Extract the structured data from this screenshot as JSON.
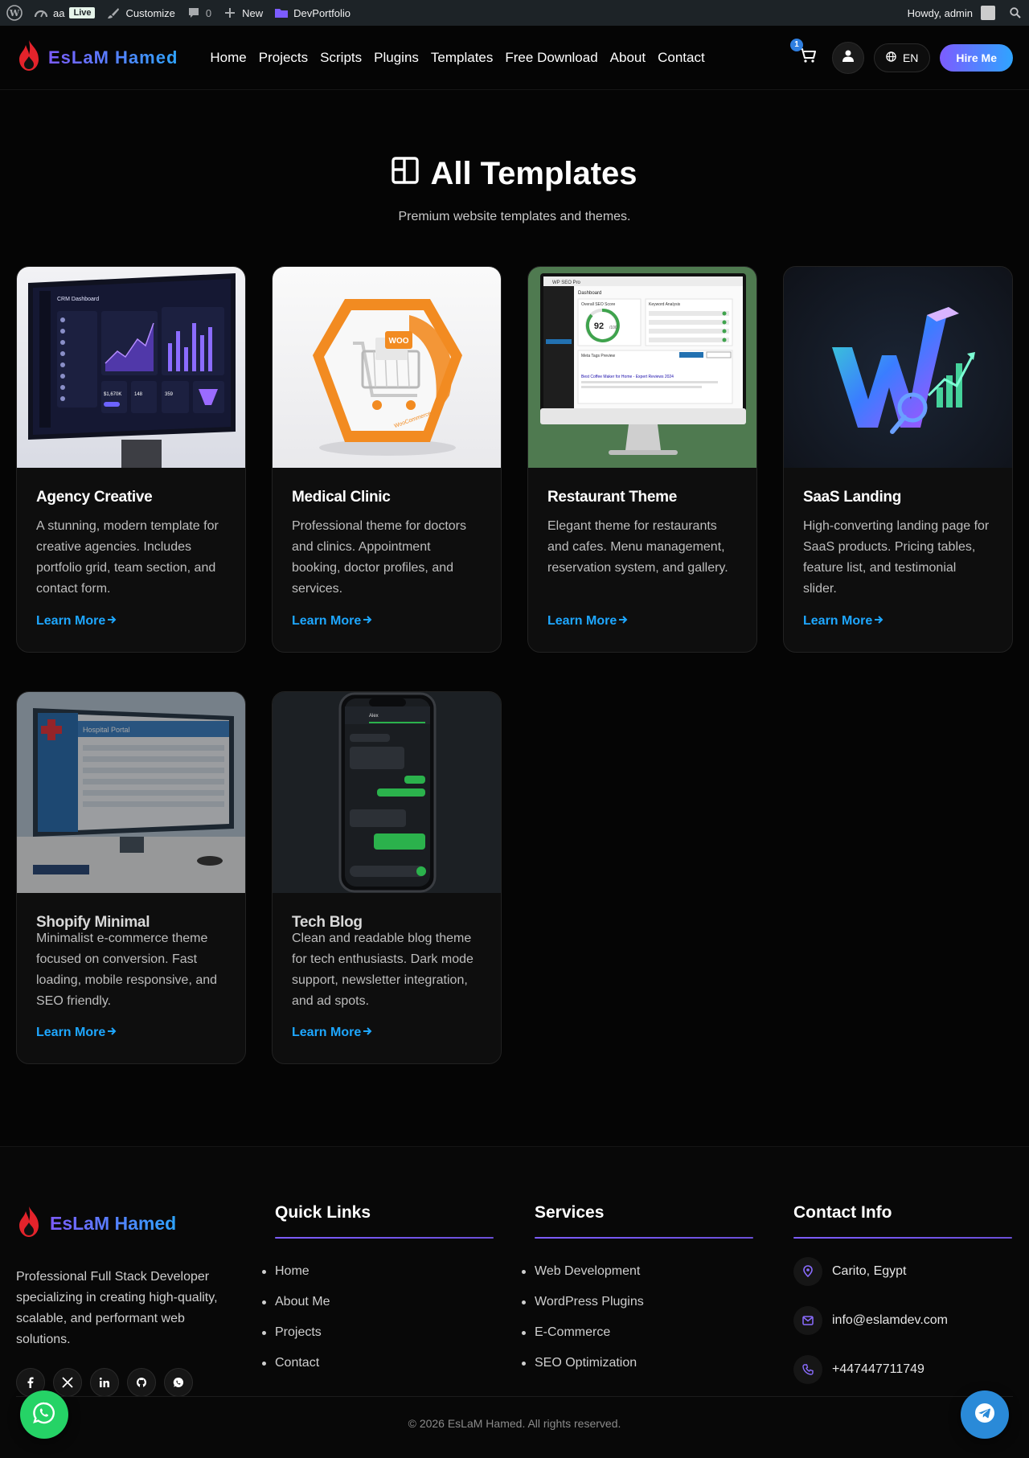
{
  "adminbar": {
    "site": "aa",
    "live": "Live",
    "customize": "Customize",
    "comments": "0",
    "new": "New",
    "plugin": "DevPortfolio",
    "howdy": "Howdy, admin"
  },
  "header": {
    "logo": "EsLaM Hamed",
    "nav": [
      "Home",
      "Projects",
      "Scripts",
      "Plugins",
      "Templates",
      "Free Download",
      "About",
      "Contact"
    ],
    "cart_count": "1",
    "lang": "EN",
    "hire": "Hire Me"
  },
  "hero": {
    "title": "All Templates",
    "subtitle": "Premium website templates and themes."
  },
  "cards": [
    {
      "title": "Agency Creative",
      "desc": "A stunning, modern template for creative agencies. Includes portfolio grid, team section, and contact form.",
      "link": "Learn More"
    },
    {
      "title": "Medical Clinic",
      "desc": "Professional theme for doctors and clinics. Appointment booking, doctor profiles, and services.",
      "link": "Learn More"
    },
    {
      "title": "Restaurant Theme",
      "desc": "Elegant theme for restaurants and cafes. Menu management, reservation system, and gallery.",
      "link": "Learn More"
    },
    {
      "title": "SaaS Landing",
      "desc": "High-converting landing page for SaaS products. Pricing tables, feature list, and testimonial slider.",
      "link": "Learn More"
    },
    {
      "title": "Shopify Minimal",
      "desc": "Minimalist e-commerce theme focused on conversion. Fast loading, mobile responsive, and SEO friendly.",
      "link": "Learn More"
    },
    {
      "title": "Tech Blog",
      "desc": "Clean and readable blog theme for tech enthusiasts. Dark mode support, newsletter integration, and ad spots.",
      "link": "Learn More"
    }
  ],
  "thumbs": {
    "agency": {
      "title": "CRM Dashboard",
      "stat1": "$1,670K",
      "stat2": "148",
      "stat3": "359"
    },
    "woo": {
      "badge": "WOO",
      "label": "WooCommerce"
    },
    "seo": {
      "app": "WP SEO Pro",
      "header": "Dashboard",
      "score_label": "Overall SEO Score",
      "score": "92",
      "score_max": "/100",
      "kw": "Keyword Analysis",
      "meta": "Meta Tags Preview",
      "preview_title": "Best Coffee Maker for Home - Expert Reviews 2024"
    },
    "hospital": {
      "title": "Hospital Portal"
    },
    "chat": {
      "name": "Alex"
    }
  },
  "footer": {
    "brand": "EsLaM Hamed",
    "about": "Professional Full Stack Developer specializing in creating high-quality, scalable, and performant web solutions.",
    "quick_title": "Quick Links",
    "quick_links": [
      "Home",
      "About Me",
      "Projects",
      "Contact"
    ],
    "services_title": "Services",
    "services": [
      "Web Development",
      "WordPress Plugins",
      "E-Commerce",
      "SEO Optimization"
    ],
    "contact_title": "Contact Info",
    "location": "Carito, Egypt",
    "email": "info@eslamdev.com",
    "phone": "+447447711749",
    "copyright": "© 2026 EsLaM Hamed. All rights reserved."
  },
  "colors": {
    "accent": "#1ea7ff",
    "brand_start": "#7c5cff",
    "brand_end": "#2fa4ff",
    "whatsapp": "#25d366",
    "telegram": "#2a8ad8"
  }
}
